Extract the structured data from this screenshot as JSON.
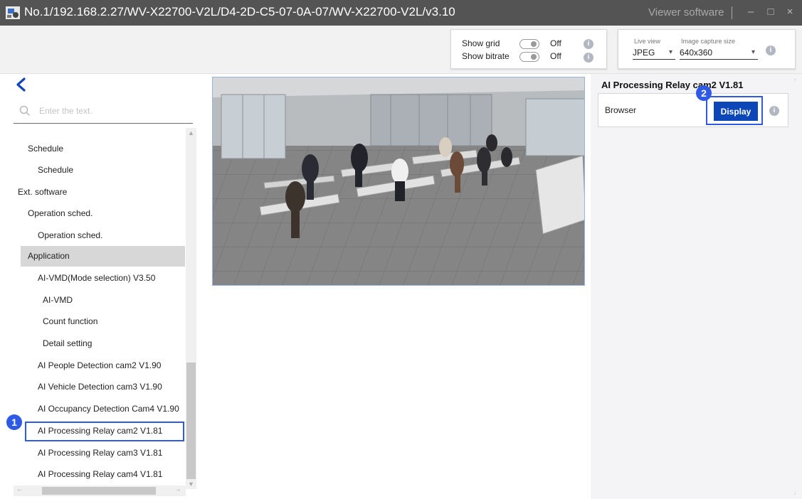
{
  "window": {
    "title": "No.1/192.168.2.27/WV-X22700-V2L/D4-2D-C5-07-0A-07/WV-X22700-V2L/v3.10",
    "app_name": "Viewer software",
    "minimize": "–",
    "maximize": "□",
    "close": "×"
  },
  "toolbar": {
    "show_grid_label": "Show grid",
    "show_grid_value": "Off",
    "show_bitrate_label": "Show bitrate",
    "show_bitrate_value": "Off",
    "live_view_label": "Live view",
    "live_view_value": "JPEG",
    "capture_size_label": "Image capture size",
    "capture_size_value": "640x360",
    "info": "i"
  },
  "search": {
    "placeholder": "Enter the text."
  },
  "tree": {
    "items": [
      "Schedule",
      "Schedule",
      "Ext. software",
      "Operation sched.",
      "Operation sched.",
      "Application",
      "AI-VMD(Mode selection) V3.50",
      "AI-VMD",
      "Count function",
      "Detail setting",
      "AI People Detection cam2 V1.90",
      "AI Vehicle Detection cam3 V1.90",
      "AI Occupancy Detection Cam4 V1.90",
      "AI Processing Relay cam2 V1.81",
      "AI Processing Relay cam3 V1.81",
      "AI Processing Relay cam4 V1.81"
    ],
    "selected_index": 5,
    "step1_badge": "1"
  },
  "right_panel": {
    "title": "AI Processing Relay cam2 V1.81",
    "browser_label": "Browser",
    "display_button": "Display",
    "step2_badge": "2"
  },
  "colors": {
    "titlebar": "#545454",
    "accent_blue": "#0d47b7",
    "highlight_blue": "#2e5ae6",
    "selected_row": "#d7d7d7"
  }
}
